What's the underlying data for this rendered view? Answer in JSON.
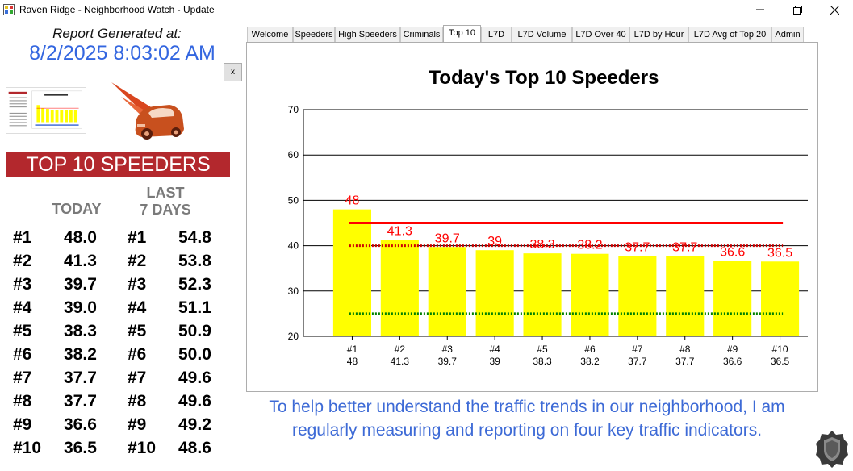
{
  "window": {
    "title": "Raven Ridge - Neighborhood Watch - Update"
  },
  "icons": {
    "app": "app-icon",
    "minimize": "minimize-icon",
    "maximize": "maximize-icon",
    "close": "close-icon",
    "badge": "shield-badge-icon",
    "car": "speeding-car-logo"
  },
  "left": {
    "report_label": "Report Generated at:",
    "report_date": "8/2/2025 8:03:02 AM",
    "x_button": "x",
    "banner": "TOP 10 SPEEDERS",
    "today_header": "TODAY",
    "last_header_line1": "LAST",
    "last_header_line2": "7 DAYS",
    "rows": [
      {
        "rank_today": "#1",
        "today": "48.0",
        "rank_last": "#1",
        "last": "54.8"
      },
      {
        "rank_today": "#2",
        "today": "41.3",
        "rank_last": "#2",
        "last": "53.8"
      },
      {
        "rank_today": "#3",
        "today": "39.7",
        "rank_last": "#3",
        "last": "52.3"
      },
      {
        "rank_today": "#4",
        "today": "39.0",
        "rank_last": "#4",
        "last": "51.1"
      },
      {
        "rank_today": "#5",
        "today": "38.3",
        "rank_last": "#5",
        "last": "50.9"
      },
      {
        "rank_today": "#6",
        "today": "38.2",
        "rank_last": "#6",
        "last": "50.0"
      },
      {
        "rank_today": "#7",
        "today": "37.7",
        "rank_last": "#7",
        "last": "49.6"
      },
      {
        "rank_today": "#8",
        "today": "37.7",
        "rank_last": "#8",
        "last": "49.6"
      },
      {
        "rank_today": "#9",
        "today": "36.6",
        "rank_last": "#9",
        "last": "49.2"
      },
      {
        "rank_today": "#10",
        "today": "36.5",
        "rank_last": "#10",
        "last": "48.6"
      }
    ]
  },
  "tabs": [
    {
      "label": "Welcome",
      "active": false
    },
    {
      "label": "Speeders",
      "active": false
    },
    {
      "label": "High Speeders",
      "active": false
    },
    {
      "label": "Criminals",
      "active": false
    },
    {
      "label": "Top 10",
      "active": true
    },
    {
      "label": "L7D",
      "active": false
    },
    {
      "label": "L7D Volume",
      "active": false
    },
    {
      "label": "L7D Over 40",
      "active": false
    },
    {
      "label": "L7D by Hour",
      "active": false
    },
    {
      "label": "L7D Avg of Top 20",
      "active": false
    },
    {
      "label": "Admin",
      "active": false
    }
  ],
  "chart_data": {
    "type": "bar",
    "title": "Today's Top 10 Speeders",
    "categories": [
      "#1",
      "#2",
      "#3",
      "#4",
      "#5",
      "#6",
      "#7",
      "#8",
      "#9",
      "#10"
    ],
    "category_sublabels": [
      "48",
      "41.3",
      "39.7",
      "39",
      "38.3",
      "38.2",
      "37.7",
      "37.7",
      "36.6",
      "36.5"
    ],
    "values": [
      48,
      41.3,
      39.7,
      39,
      38.3,
      38.2,
      37.7,
      37.7,
      36.6,
      36.5
    ],
    "data_labels": [
      "48",
      "41.3",
      "39.7",
      "39",
      "38.3",
      "38.2",
      "37.7",
      "37.7",
      "36.6",
      "36.5"
    ],
    "ylim": [
      20,
      70
    ],
    "yticks": [
      "20",
      "30",
      "40",
      "50",
      "60",
      "70"
    ],
    "grid": true,
    "bar_color": "#ffff00",
    "label_color": "#ff0000",
    "reference_lines": [
      {
        "value": 45,
        "style": "solid",
        "color": "#ff0000"
      },
      {
        "value": 40,
        "style": "dotted",
        "color": "#cc0000"
      },
      {
        "value": 25,
        "style": "dotted",
        "color": "#008000"
      }
    ]
  },
  "footer": {
    "text": "To help better understand the traffic trends in our neighborhood, I am regularly measuring and reporting on four key traffic indicators."
  },
  "colors": {
    "date_blue": "#3366e0",
    "banner_red": "#b3282d",
    "header_gray": "#7a7a7a",
    "footer_blue": "#3d6ad6"
  }
}
